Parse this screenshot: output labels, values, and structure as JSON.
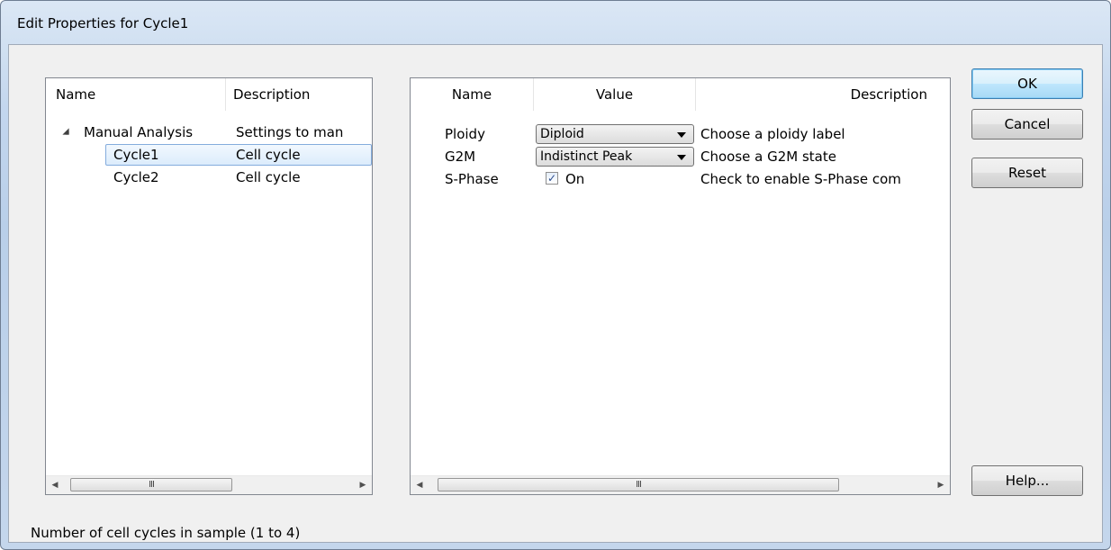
{
  "window": {
    "title": "Edit Properties for Cycle1"
  },
  "left_panel": {
    "columns": [
      "Name",
      "Description"
    ],
    "rows": [
      {
        "name": "Manual Analysis",
        "description": "Settings to man",
        "expanded": true
      },
      {
        "name": "Cycle1",
        "description": "Cell cycle",
        "selected": true
      },
      {
        "name": "Cycle2",
        "description": "Cell cycle"
      }
    ],
    "scroll_thumb_grip": "III"
  },
  "right_panel": {
    "columns": [
      "Name",
      "Value",
      "Description"
    ],
    "rows": [
      {
        "name": "Ploidy",
        "value": "Diploid",
        "description": "Choose a ploidy label"
      },
      {
        "name": "G2M",
        "value": "Indistinct Peak",
        "description": "Choose a G2M state"
      },
      {
        "name": "S-Phase",
        "value": "On",
        "checked": true,
        "description": "Check to enable S-Phase com"
      }
    ],
    "scroll_thumb_grip": "III"
  },
  "buttons": {
    "ok": "OK",
    "cancel": "Cancel",
    "reset": "Reset",
    "help": "Help..."
  },
  "status_text": "Number of cell cycles in sample (1 to 4)",
  "colors": {
    "selection_border": "#84acdd",
    "default_button_border": "#3c7fb1",
    "title_bar": "#cfdff1"
  }
}
